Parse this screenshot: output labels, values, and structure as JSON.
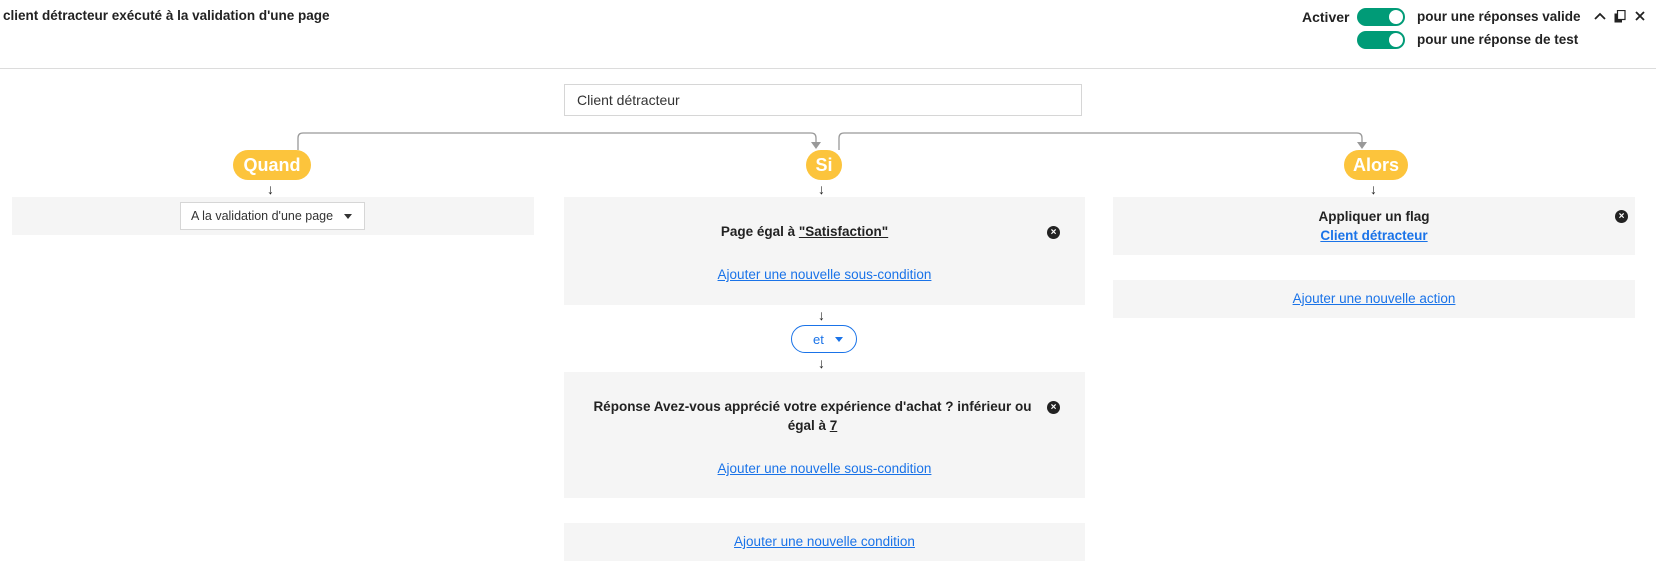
{
  "header": {
    "title": "client détracteur exécuté à la validation d'une page",
    "activer_label": "Activer",
    "toggles": [
      {
        "label": "pour une réponses valide",
        "on": true
      },
      {
        "label": "pour une réponse de test",
        "on": true
      }
    ],
    "icons": [
      "chevron-up-icon",
      "copy-icon",
      "close-icon"
    ]
  },
  "rule": {
    "name_value": "Client détracteur"
  },
  "columns": {
    "quand": {
      "pill": "Quand",
      "trigger_value": "A la validation d'une page"
    },
    "si": {
      "pill": "Si",
      "conditions": [
        {
          "prefix": "Page égal à ",
          "value": "\"Satisfaction\"",
          "add_sub": "Ajouter une nouvelle sous-condition"
        },
        {
          "prefix": "Réponse Avez-vous apprécié votre expérience d'achat ? inférieur ou égal à ",
          "value": "7",
          "add_sub": "Ajouter une nouvelle sous-condition"
        }
      ],
      "operator": "et",
      "add_condition": "Ajouter une nouvelle condition"
    },
    "alors": {
      "pill": "Alors",
      "action_title": "Appliquer un flag",
      "action_value": "Client détracteur",
      "add_action": "Ajouter une nouvelle action"
    }
  },
  "colors": {
    "accent_yellow": "#fcc43c",
    "toggle_green": "#009b77",
    "link_blue": "#1a73e8",
    "panel_bg": "#f5f5f5"
  }
}
